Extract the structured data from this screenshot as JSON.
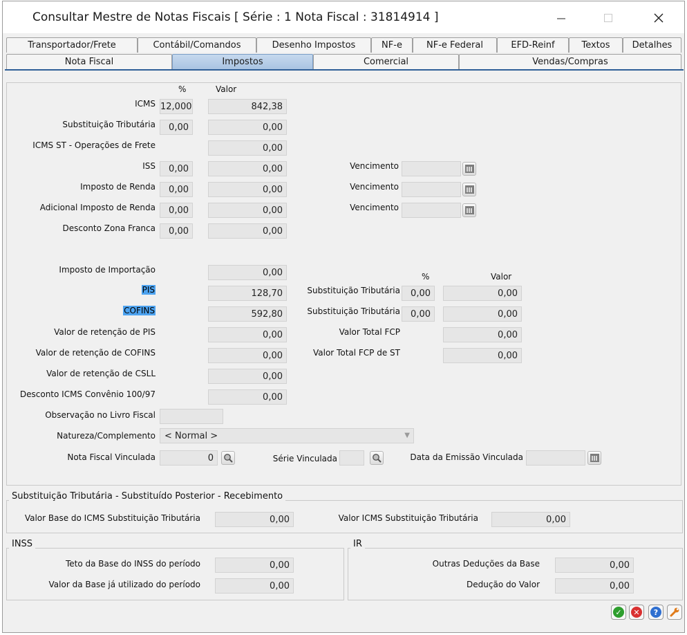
{
  "window": {
    "title": "Consultar Mestre de Notas Fiscais [ Série : 1   Nota Fiscal : 31814914 ]"
  },
  "tabs_row1": [
    "Transportador/Frete",
    "Contábil/Comandos",
    "Desenho Impostos",
    "NF-e",
    "NF-e Federal",
    "EFD-Reinf",
    "Textos",
    "Detalhes"
  ],
  "tabs_row2": [
    "Nota Fiscal",
    "Impostos",
    "Comercial",
    "Vendas/Compras"
  ],
  "cols": {
    "pct": "%",
    "valor": "Valor"
  },
  "taxes": {
    "icms": {
      "label": "ICMS",
      "pct": "12,0000",
      "valor": "842,38"
    },
    "st": {
      "label": "Substituição Tributária",
      "pct": "0,00",
      "valor": "0,00"
    },
    "icms_st_frete": {
      "label": "ICMS ST - Operações de Frete",
      "valor": "0,00"
    },
    "iss": {
      "label": "ISS",
      "pct": "0,00",
      "valor": "0,00",
      "venc_label": "Vencimento",
      "venc": ""
    },
    "ir": {
      "label": "Imposto de Renda",
      "pct": "0,00",
      "valor": "0,00",
      "venc_label": "Vencimento",
      "venc": ""
    },
    "adic_ir": {
      "label": "Adicional Imposto de Renda",
      "pct": "0,00",
      "valor": "0,00",
      "venc_label": "Vencimento",
      "venc": ""
    },
    "desc_zf": {
      "label": "Desconto Zona Franca",
      "pct": "0,00",
      "valor": "0,00"
    },
    "imp_import": {
      "label": "Imposto de Importação",
      "valor": "0,00"
    },
    "pis": {
      "label": "PIS",
      "valor": "128,70"
    },
    "cofins": {
      "label": "COFINS",
      "valor": "592,80"
    },
    "ret_pis": {
      "label": "Valor de retenção de PIS",
      "valor": "0,00"
    },
    "ret_cofins": {
      "label": "Valor de retenção de COFINS",
      "valor": "0,00"
    },
    "ret_csll": {
      "label": "Valor de retenção de CSLL",
      "valor": "0,00"
    },
    "desc_icms": {
      "label": "Desconto ICMS Convênio 100/97",
      "valor": "0,00"
    },
    "obs_livro": {
      "label": "Observação no Livro Fiscal",
      "valor": ""
    },
    "natureza": {
      "label": "Natureza/Complemento",
      "valor": "< Normal >"
    },
    "nf_vinc": {
      "label": "Nota Fiscal Vinculada",
      "valor": "0"
    },
    "serie_vinc": {
      "label": "Série Vinculada",
      "valor": ""
    },
    "data_emissao": {
      "label": "Data da Emissão Vinculada",
      "valor": ""
    }
  },
  "right": {
    "pct": "%",
    "valor": "Valor",
    "st_pis": {
      "label": "Substituição Tributária",
      "pct": "0,00",
      "valor": "0,00"
    },
    "st_cofins": {
      "label": "Substituição Tributária",
      "pct": "0,00",
      "valor": "0,00"
    },
    "fcp": {
      "label": "Valor Total FCP",
      "valor": "0,00"
    },
    "fcp_st": {
      "label": "Valor Total FCP de ST",
      "valor": "0,00"
    }
  },
  "st_group": {
    "title": "Substituição Tributária - Substituído Posterior - Recebimento",
    "base_label": "Valor Base do ICMS Substituição Tributária",
    "base": "0,00",
    "icms_label": "Valor ICMS Substituição Tributária",
    "icms": "0,00"
  },
  "inss": {
    "title": "INSS",
    "teto_label": "Teto da Base do INSS do período",
    "teto": "0,00",
    "util_label": "Valor da Base já utilizado do período",
    "util": "0,00"
  },
  "irg": {
    "title": "IR",
    "outras_label": "Outras Deduções da Base",
    "outras": "0,00",
    "ded_label": "Dedução do Valor",
    "ded": "0,00"
  },
  "colors": {
    "accent": "#2f5f97",
    "highlight": "#4da3f0",
    "ok": "#2e9e2e",
    "cancel": "#d93030",
    "help": "#2f6fd0",
    "tool": "#e07b1a"
  }
}
